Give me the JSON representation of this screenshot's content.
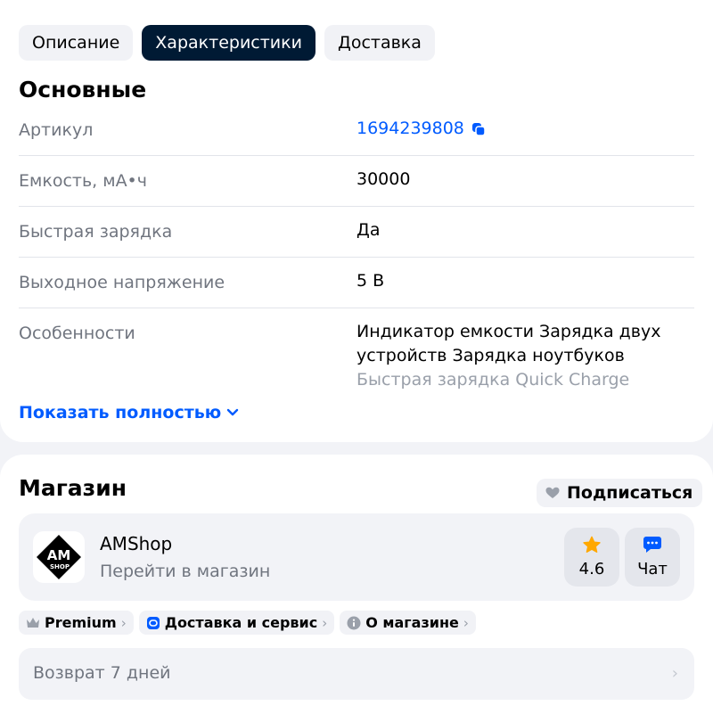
{
  "tabs": [
    {
      "label": "Описание",
      "active": false
    },
    {
      "label": "Характеристики",
      "active": true
    },
    {
      "label": "Доставка",
      "active": false
    }
  ],
  "specs": {
    "title": "Основные",
    "rows": [
      {
        "key": "Артикул",
        "value": "1694239808"
      },
      {
        "key": "Емкость, мА•ч",
        "value": "30000"
      },
      {
        "key": "Быстрая зарядка",
        "value": "Да"
      },
      {
        "key": "Выходное напряжение",
        "value": "5 В"
      },
      {
        "key": "Особенности",
        "value_lines": [
          "Индикатор емкости Зарядка двух",
          "устройств Зарядка ноутбуков",
          "Быстрая зарядка Quick Charge"
        ]
      }
    ],
    "show_more": "Показать полностью"
  },
  "shop": {
    "title": "Магазин",
    "subscribe": "Подписаться",
    "name": "AMShop",
    "logo_text": "AM",
    "logo_subtext": "SHOP",
    "go_to_store": "Перейти в магазин",
    "rating": "4.6",
    "chat": "Чат",
    "chips": [
      {
        "label": "Premium",
        "icon": "crown-icon"
      },
      {
        "label": "Доставка и сервис",
        "icon": "delivery-service-icon"
      },
      {
        "label": "О магазине",
        "icon": "info-icon"
      }
    ],
    "return_policy": "Возврат 7 дней"
  },
  "colors": {
    "accent": "#005bff",
    "active_tab": "#001a34",
    "star": "#ffa800",
    "muted_text": "#70757f"
  }
}
